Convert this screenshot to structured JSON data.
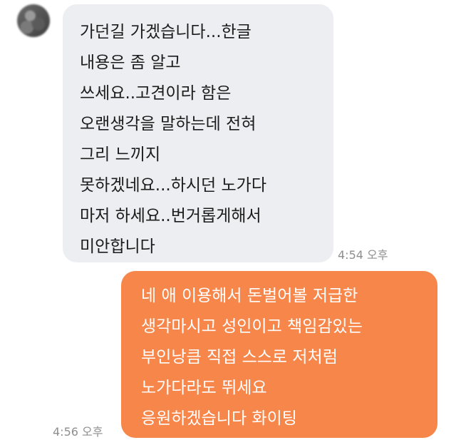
{
  "conversation": {
    "incoming": {
      "lines": [
        "가던길 가겠습니다...한글",
        "내용은 좀 알고",
        "쓰세요..고견이라 함은",
        "오랜생각을 말하는데 전혀",
        "그리 느끼지",
        "못하겠네요...하시던 노가다",
        "마저 하세요..번거롭게해서",
        "미안합니다"
      ],
      "time": "4:54 오후"
    },
    "outgoing": {
      "lines": [
        "네 애 이용해서 돈벌어볼 저급한",
        "생각마시고 성인이고 책임감있는",
        "부인낭큼 직접 스스로 저처럼",
        "노가다라도 뛰세요",
        "응원하겠습니다 화이팅"
      ],
      "time": "4:56 오후"
    }
  },
  "colors": {
    "incoming_bubble": "#eceef1",
    "outgoing_bubble": "#f7864a",
    "timestamp": "#8e8e8e"
  },
  "icons": {
    "avatar": "blurred-profile-avatar"
  }
}
